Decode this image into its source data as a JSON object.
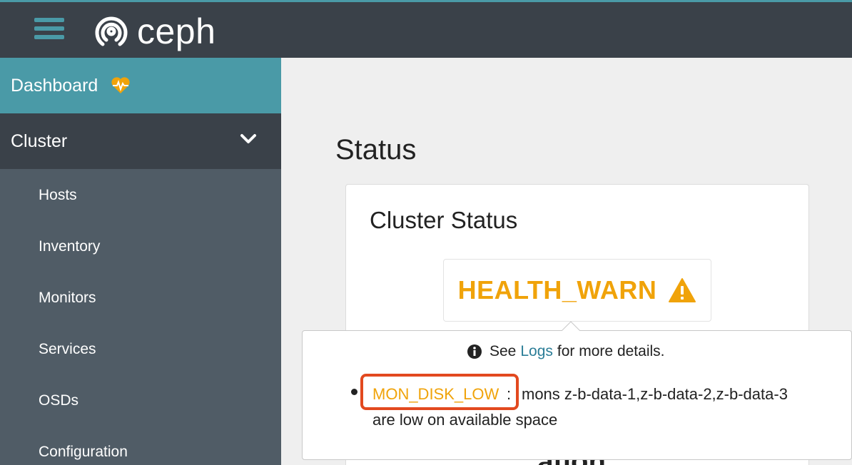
{
  "header": {
    "logo_text": "ceph",
    "accent_color": "#4a9aa7"
  },
  "sidebar": {
    "dashboard_label": "Dashboard",
    "cluster_label": "Cluster",
    "items": [
      {
        "label": "Hosts"
      },
      {
        "label": "Inventory"
      },
      {
        "label": "Monitors"
      },
      {
        "label": "Services"
      },
      {
        "label": "OSDs"
      },
      {
        "label": "Configuration"
      }
    ]
  },
  "main": {
    "page_title": "Status",
    "card_title": "Cluster Status",
    "health_status": "HEALTH_WARN",
    "health_color": "#f0a30a",
    "next_section_partial": "...ation"
  },
  "popover": {
    "see_text": "See",
    "logs_link": "Logs",
    "details_text": "for more details.",
    "check_code": "MON_DISK_LOW",
    "colon": ":",
    "message_line1": "mons z-b-data-1,z-b-data-2,z-b-data-3",
    "message_line2": "are low on available space"
  }
}
